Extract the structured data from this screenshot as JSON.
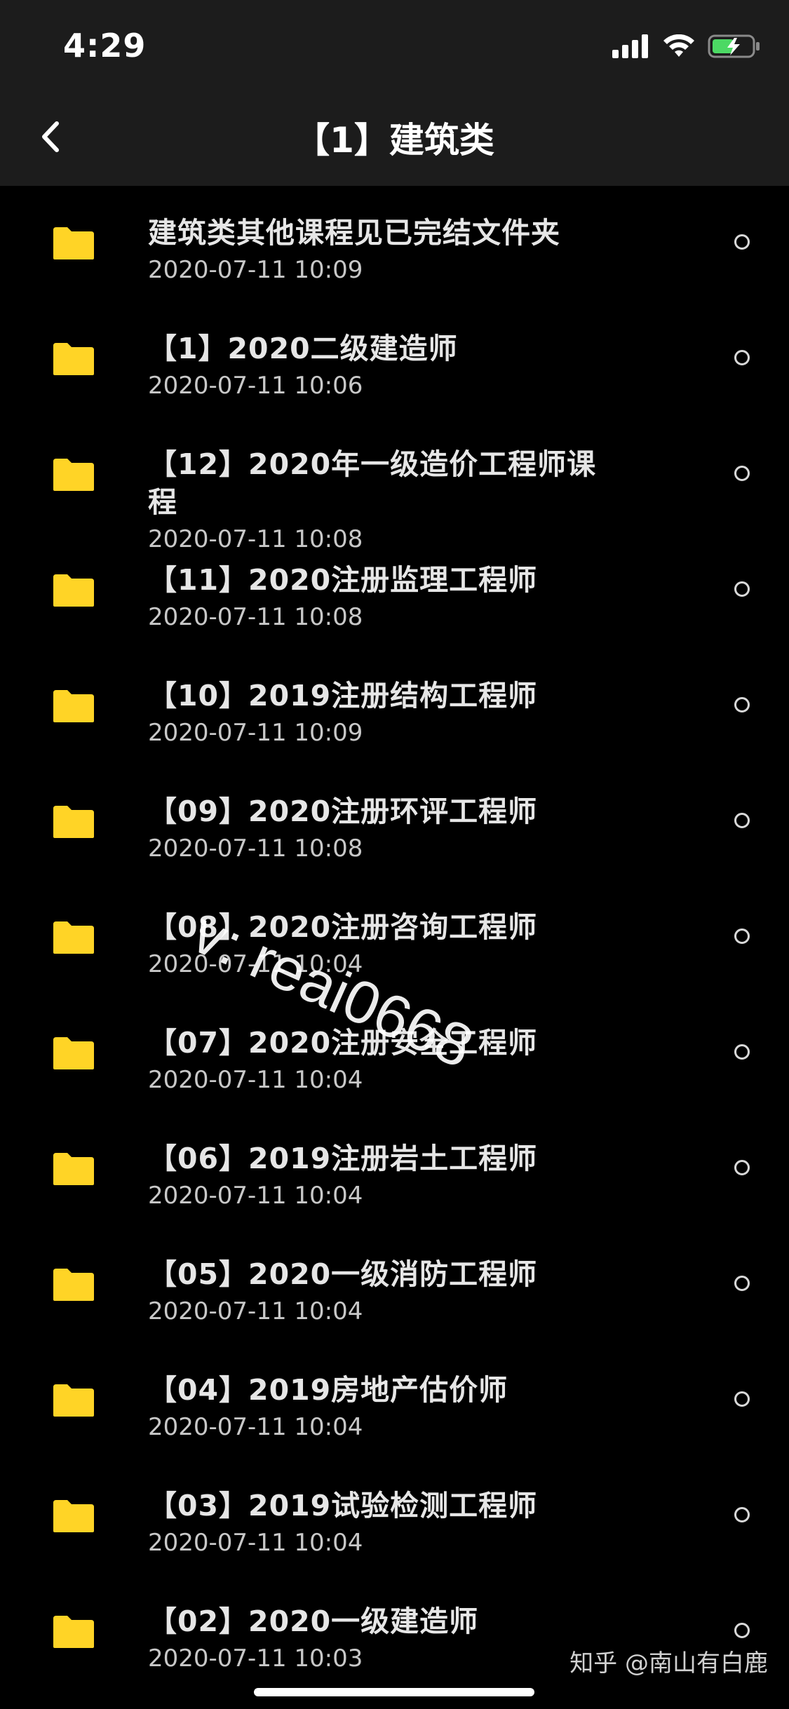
{
  "status_bar": {
    "time": "4:29"
  },
  "nav": {
    "title": "【1】建筑类"
  },
  "items": [
    {
      "name": "建筑类其他课程见已完结文件夹",
      "date": "2020-07-11 10:09"
    },
    {
      "name": "【1】2020二级建造师",
      "date": "2020-07-11 10:06"
    },
    {
      "name": "【12】2020年一级造价工程师课程",
      "date": "2020-07-11 10:08"
    },
    {
      "name": "【11】2020注册监理工程师",
      "date": "2020-07-11 10:08"
    },
    {
      "name": "【10】2019注册结构工程师",
      "date": "2020-07-11 10:09"
    },
    {
      "name": "【09】2020注册环评工程师",
      "date": "2020-07-11 10:08"
    },
    {
      "name": "【08】2020注册咨询工程师",
      "date": "2020-07-11 10:04"
    },
    {
      "name": "【07】2020注册安全工程师",
      "date": "2020-07-11 10:04"
    },
    {
      "name": "【06】2019注册岩土工程师",
      "date": "2020-07-11 10:04"
    },
    {
      "name": "【05】2020一级消防工程师",
      "date": "2020-07-11 10:04"
    },
    {
      "name": "【04】2019房地产估价师",
      "date": "2020-07-11 10:04"
    },
    {
      "name": "【03】2019试验检测工程师",
      "date": "2020-07-11 10:04"
    },
    {
      "name": "【02】2020一级建造师",
      "date": "2020-07-11 10:03"
    }
  ],
  "watermark": "v: reai0668",
  "credit": "知乎 @南山有白鹿",
  "colors": {
    "folder": "#FFD426",
    "background": "#000000",
    "bar": "#1C1C1C",
    "battery": "#4CD964"
  }
}
